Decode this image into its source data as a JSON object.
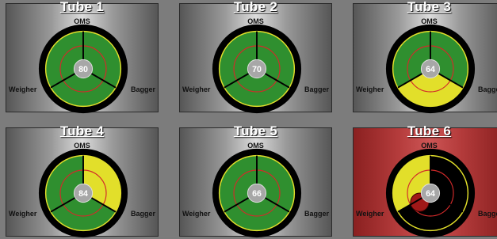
{
  "labels": {
    "top": "OMS",
    "left": "Weigher",
    "right": "Bagger"
  },
  "colors": {
    "green": "#2f8f2f",
    "yellow": "#e2df2a",
    "red": "#b21d1d",
    "black": "#000000"
  },
  "tubes": [
    {
      "title": "Tube 1",
      "value": "80",
      "alarm": false,
      "sectors": [
        "green",
        "green",
        "green"
      ]
    },
    {
      "title": "Tube 2",
      "value": "70",
      "alarm": false,
      "sectors": [
        "green",
        "green",
        "green"
      ]
    },
    {
      "title": "Tube 3",
      "value": "64",
      "alarm": false,
      "sectors": [
        "green",
        "green",
        "yellow"
      ]
    },
    {
      "title": "Tube 4",
      "value": "84",
      "alarm": false,
      "sectors": [
        "green",
        "yellow",
        "green"
      ]
    },
    {
      "title": "Tube 5",
      "value": "66",
      "alarm": false,
      "sectors": [
        "green",
        "green",
        "green"
      ]
    },
    {
      "title": "Tube 6",
      "value": "64",
      "alarm": true,
      "sectors": [
        "yellow",
        "black",
        "black"
      ]
    }
  ]
}
